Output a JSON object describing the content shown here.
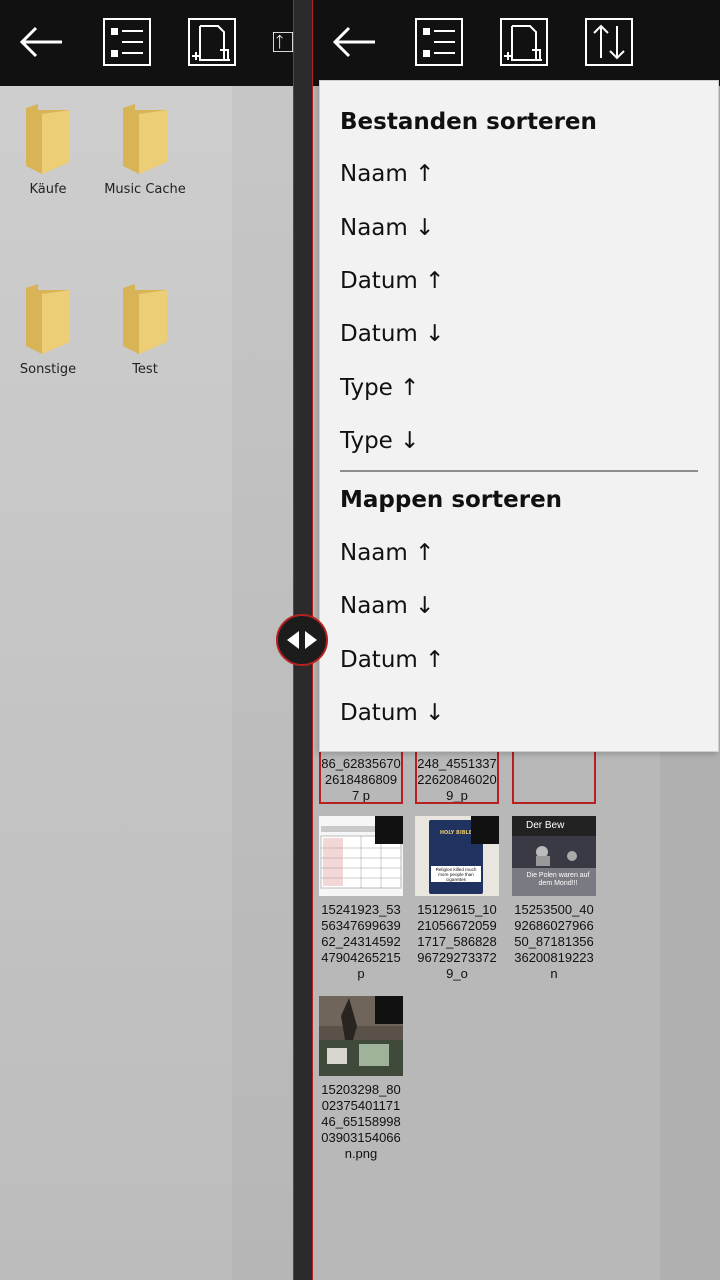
{
  "left_pane": {
    "folders": [
      {
        "name": "Käufe"
      },
      {
        "name": "Music Cache"
      },
      {
        "name": "Sonstige"
      },
      {
        "name": "Test"
      }
    ]
  },
  "toolbar": {
    "buttons": [
      "back-arrow-icon",
      "list-view-icon",
      "new-folder-icon",
      "sort-icon"
    ]
  },
  "right_pane": {
    "partial_items": [
      {
        "label": "86_6283567026184868097 p"
      },
      {
        "label": "248_4551337226208460209_p"
      },
      {
        "label": ""
      }
    ],
    "items": [
      {
        "label": "15241923_5356347699639 62_2431459247904265215 p"
      },
      {
        "label": "15129615_1021056672059 1717_586828967292733729_o"
      },
      {
        "label": "15253500_4092686027966 50_8718135636200819223 n"
      },
      {
        "label": "15203298_8002375401171 46_6515899803903154066 n.png"
      }
    ],
    "thumb_texts": {
      "bible_title": "HOLY BIBLE",
      "bible_caption": "Religion killed much more people than cigarettes",
      "moon_top": "Der Bew",
      "moon_bottom": "Die Polen waren auf dem Mond!!!"
    }
  },
  "sort_menu": {
    "files_heading": "Bestanden sorteren",
    "files_options": [
      "Naam ↑",
      "Naam ↓",
      "Datum ↑",
      "Datum ↓",
      "Type ↑",
      "Type ↓"
    ],
    "folders_heading": "Mappen sorteren",
    "folders_options": [
      "Naam ↑",
      "Naam ↓",
      "Datum ↑",
      "Datum ↓"
    ]
  },
  "colors": {
    "accent_red": "#b52020",
    "toolbar_bg": "#111111",
    "menu_bg": "#f2f2f2",
    "folder_yellow": "#e8c86a"
  }
}
